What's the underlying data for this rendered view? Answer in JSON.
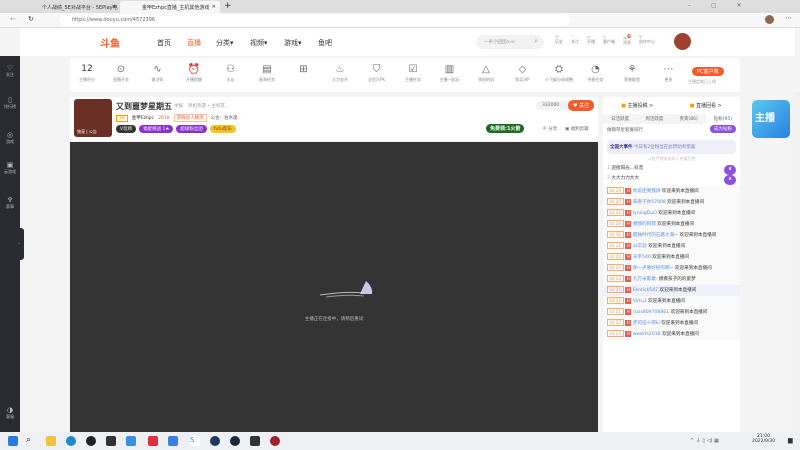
{
  "browser": {
    "tabs": [
      {
        "title": "个人战绩_5E对战平台 - 5EPlay电"
      },
      {
        "title": "金甲Ezhpc直播_主机其他游戏"
      }
    ],
    "url": "https://www.douyu.com/4572396",
    "new_tab": "+"
  },
  "site": {
    "logo": "斗鱼",
    "nav": [
      "首页",
      "直播",
      "分类▾",
      "视频▾",
      "游戏▾",
      "鱼吧"
    ],
    "search_placeholder": "一条小团团ovo",
    "header_icons": [
      "历史",
      "关注",
      "开播",
      "客户端",
      "消息",
      "创作中心"
    ],
    "msg_badge": "99"
  },
  "sidebar": [
    "关注",
    "排行榜",
    "游戏",
    "云游戏",
    "赛事",
    "客服"
  ],
  "toolbar": {
    "score": "12",
    "score_label": "主播积分",
    "items": [
      "直播开关",
      "做活码",
      "开播提醒",
      "水友",
      "星海任务",
      "",
      "大力金开",
      "全民乐PK",
      "主播任务",
      "主播一起玩",
      "领机的机",
      "购买VIP",
      "小飞碟分成调整",
      "充能任务",
      "荣誉殿堂",
      "更多"
    ],
    "pc_button": "PC客户端",
    "pc_sub": "主播定制已上线"
  },
  "room": {
    "title": "又到噩梦星期五",
    "report": "举报",
    "category": "单机热游 • 主机其...",
    "level": "18",
    "anchor": "金甲Ezhpc",
    "heat": "2618",
    "tag": "游戏达人精英",
    "notice": "公会：伯木菌",
    "badges": [
      "V玩师",
      "福星挑战 1★",
      "超级粉丝团",
      "fufu欢乐"
    ],
    "followers": "332000",
    "follow": "关注",
    "free": "免费领:1火箭",
    "share": "分享",
    "clip": "福利剪辑",
    "avatar_tag": "独宠 | 公告"
  },
  "player": {
    "status": "主播正在连接中，请稍后重试"
  },
  "panel": {
    "tabs_top": [
      "主播投稿 >",
      "直播回看 >"
    ],
    "tabs": [
      "日活跃度",
      "周活跃度",
      "贵宾(86)",
      "钻粉(95)"
    ],
    "rank_title": "做钢琴星套餐排行",
    "join": "成为钻粉",
    "event": "全国大事件",
    "event_desc": "今日有2位粉丝在此赞助有惊喜",
    "notice": "斗鱼严禁未成年人充值打赏",
    "ranks": [
      {
        "n": "1",
        "name": "迎接阳光...抖音"
      },
      {
        "n": "2",
        "name": "大大力力大大"
      }
    ],
    "chat": [
      {
        "lv": "LV 24",
        "name": "你说还要我讲",
        "msg": "欢迎来到本直播间"
      },
      {
        "lv": "LV 20",
        "name": "味香子你57908",
        "msg": "欢迎来到本直播间"
      },
      {
        "lv": "LV 26",
        "name": "lyningDuO",
        "msg": "欢迎来到本直播间"
      },
      {
        "lv": "LV 29",
        "name": "想我的阿叔",
        "msg": "欢迎来到本直播间"
      },
      {
        "lv": "LV 36",
        "name": "孤独时代的石路大海~",
        "msg": "欢迎来到本直播间"
      },
      {
        "lv": "LV 21",
        "name": "zz实验",
        "msg": "欢迎来到本直播间"
      },
      {
        "lv": "LV 24",
        "name": "天宇540",
        "msg": "欢迎来到本直播间"
      },
      {
        "lv": "LV 25",
        "name": "你一点要好好的啊~",
        "msg": "欢迎来到本直播间"
      },
      {
        "lv": "LV 23",
        "name": "九万米影歌:",
        "msg": "摸摸孩子的的噩梦"
      },
      {
        "lv": "LV 21",
        "name": "Fenrick547",
        "msg": "欢迎来到本直播间"
      },
      {
        "lv": "LV 24",
        "name": "Virtu3",
        "msg": "欢迎来到本直播间"
      },
      {
        "lv": "LV 21",
        "name": "ruos809708861",
        "msg": "欢迎来到本直播间"
      },
      {
        "lv": "LV 23",
        "name": "赤司征十郎ki",
        "msg": "欢迎来到本直播间"
      },
      {
        "lv": "LV 23",
        "name": "weekfs2018",
        "msg": "欢迎来到本直播间"
      }
    ]
  },
  "taskbar": {
    "time": "21:00",
    "date": "2022/9/30"
  }
}
